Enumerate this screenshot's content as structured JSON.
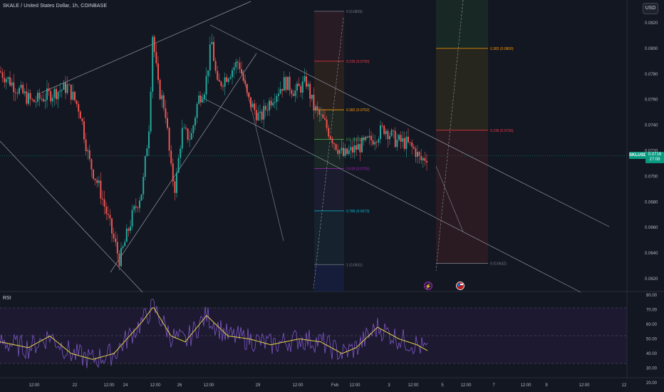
{
  "header": {
    "symbol_title": "SKALE / United States Dollar, 1h, COINBASE",
    "currency": "USD"
  },
  "price_tag": {
    "ticker": "SKLUSD",
    "price": "0.0716",
    "countdown": "27:08"
  },
  "rsi": {
    "label": "RSI",
    "axis_labels": [
      "80.00",
      "70.00",
      "60.00",
      "50.00",
      "40.00",
      "30.00",
      "20.00"
    ]
  },
  "chart_data": [
    {
      "type": "candlestick",
      "title": "SKALE / United States Dollar, 1h, COINBASE",
      "ylim": [
        0.0615,
        0.083
      ],
      "y_ticks": [
        "0.0820",
        "0.0800",
        "0.0780",
        "0.0760",
        "0.0740",
        "0.0720",
        "0.0700",
        "0.0680",
        "0.0660",
        "0.0640",
        "0.0620"
      ],
      "x_ticks": [
        "12:00",
        "22",
        "12:00",
        "24",
        "12:00",
        "26",
        "12:00",
        "29",
        "12:00",
        "Feb",
        "12:00",
        "3",
        "12:00",
        "5",
        "12:00",
        "7",
        "12:00",
        "9",
        "12:00",
        "12"
      ],
      "last_price": 0.0716,
      "fib_left": [
        {
          "label": "0 (0.0829)",
          "value": 0.0829,
          "color": "#787b86"
        },
        {
          "label": "0.236 (0.0790)",
          "value": 0.079,
          "color": "#f23645"
        },
        {
          "label": "0.382 (0.0752)",
          "value": 0.0752,
          "color": "#ff9800"
        },
        {
          "label": "0.5 (0.0729)",
          "value": 0.0729,
          "color": "#4caf50"
        },
        {
          "label": "0.618 (0.0706)",
          "value": 0.0706,
          "color": "#9c27b0"
        },
        {
          "label": "0.786 (0.0673)",
          "value": 0.0673,
          "color": "#00bcd4"
        },
        {
          "label": "1 (0.0631)",
          "value": 0.0631,
          "color": "#787b86"
        }
      ],
      "fib_right": [
        {
          "label": "0.382 (0.0800)",
          "value": 0.08,
          "color": "#ff9800"
        },
        {
          "label": "0.236 (0.0736)",
          "value": 0.0736,
          "color": "#f23645"
        },
        {
          "label": "0 (0.0632)",
          "value": 0.0632,
          "color": "#787b86"
        }
      ],
      "colors": {
        "up": "#26a69a",
        "down": "#ef5350",
        "sma": "#e6d246",
        "rsi": "#7e57c2"
      }
    },
    {
      "type": "line",
      "title": "RSI",
      "ylim": [
        20,
        80
      ],
      "y_ticks": [
        80,
        70,
        60,
        50,
        40,
        30,
        20
      ],
      "bands": [
        30,
        50,
        70
      ]
    }
  ]
}
